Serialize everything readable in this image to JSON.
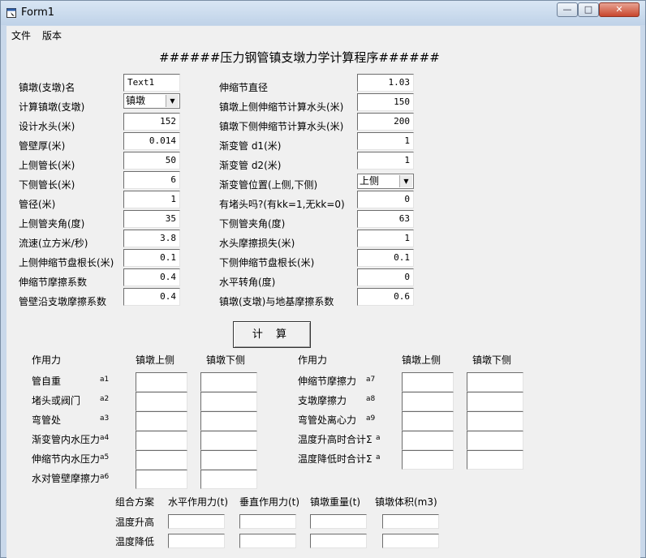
{
  "window": {
    "title": "Form1",
    "minimize": "—",
    "maximize": "□",
    "close": "✕"
  },
  "menu": [
    "文件",
    "版本"
  ],
  "heading": "######压力钢管镇支墩力学计算程序######",
  "left_fields": [
    {
      "label": "镇墩(支墩)名",
      "value": "Text1",
      "kind": "text"
    },
    {
      "label": "计算镇墩(支墩)",
      "value": "镇墩",
      "kind": "combo"
    },
    {
      "label": "设计水头(米)",
      "value": "152"
    },
    {
      "label": "管壁厚(米)",
      "value": "0.014"
    },
    {
      "label": "上侧管长(米)",
      "value": "50"
    },
    {
      "label": "下侧管长(米)",
      "value": "6"
    },
    {
      "label": "管径(米)",
      "value": "1"
    },
    {
      "label": "上侧管夹角(度)",
      "value": "35"
    },
    {
      "label": "流速(立方米/秒)",
      "value": "3.8"
    },
    {
      "label": "上侧伸缩节盘根长(米)",
      "value": "0.1"
    },
    {
      "label": "伸缩节摩擦系数",
      "value": "0.4"
    },
    {
      "label": "管壁沿支墩摩擦系数",
      "value": "0.4"
    }
  ],
  "right_fields": [
    {
      "label": "伸缩节直径",
      "value": "1.03"
    },
    {
      "label": "镇墩上侧伸缩节计算水头(米)",
      "value": "150"
    },
    {
      "label": "镇墩下侧伸缩节计算水头(米)",
      "value": "200"
    },
    {
      "label": "渐变管 d1(米)",
      "value": "1"
    },
    {
      "label": "渐变管 d2(米)",
      "value": "1"
    },
    {
      "label": "渐变管位置(上侧,下侧)",
      "value": "上侧",
      "kind": "combo"
    },
    {
      "label": "有堵头吗?(有kk=1,无kk=0)",
      "value": "0"
    },
    {
      "label": "下侧管夹角(度)",
      "value": "63"
    },
    {
      "label": "水头摩擦损失(米)",
      "value": "1"
    },
    {
      "label": "下侧伸缩节盘根长(米)",
      "value": "0.1"
    },
    {
      "label": "水平转角(度)",
      "value": "0"
    },
    {
      "label": "镇墩(支墩)与地基摩擦系数",
      "value": "0.6"
    }
  ],
  "calc_button": "计 算",
  "forces": {
    "header": {
      "name": "作用力",
      "up": "镇墩上侧",
      "down": "镇墩下侧"
    },
    "left_rows": [
      {
        "name": "管自重",
        "code": "a1"
      },
      {
        "name": "堵头或阀门",
        "code": "a2"
      },
      {
        "name": "弯管处",
        "code": "a3"
      },
      {
        "name": "渐变管内水压力",
        "code": "a4"
      },
      {
        "name": "伸缩节内水压力",
        "code": "a5"
      },
      {
        "name": "水对管壁摩擦力",
        "code": "a6"
      }
    ],
    "right_rows": [
      {
        "name": "伸缩节摩擦力",
        "code": "a7"
      },
      {
        "name": "支墩摩擦力",
        "code": "a8"
      },
      {
        "name": "弯管处离心力",
        "code": "a9"
      },
      {
        "name": "温度升高时合计Σ",
        "code": "a"
      },
      {
        "name": "温度降低时合计Σ",
        "code": "a"
      }
    ]
  },
  "combination": {
    "headers": [
      "组合方案",
      "水平作用力(t)",
      "垂直作用力(t)",
      "镇墩重量(t)",
      "镇墩体积(m3)"
    ],
    "rows": [
      "温度升高",
      "温度降低"
    ]
  }
}
